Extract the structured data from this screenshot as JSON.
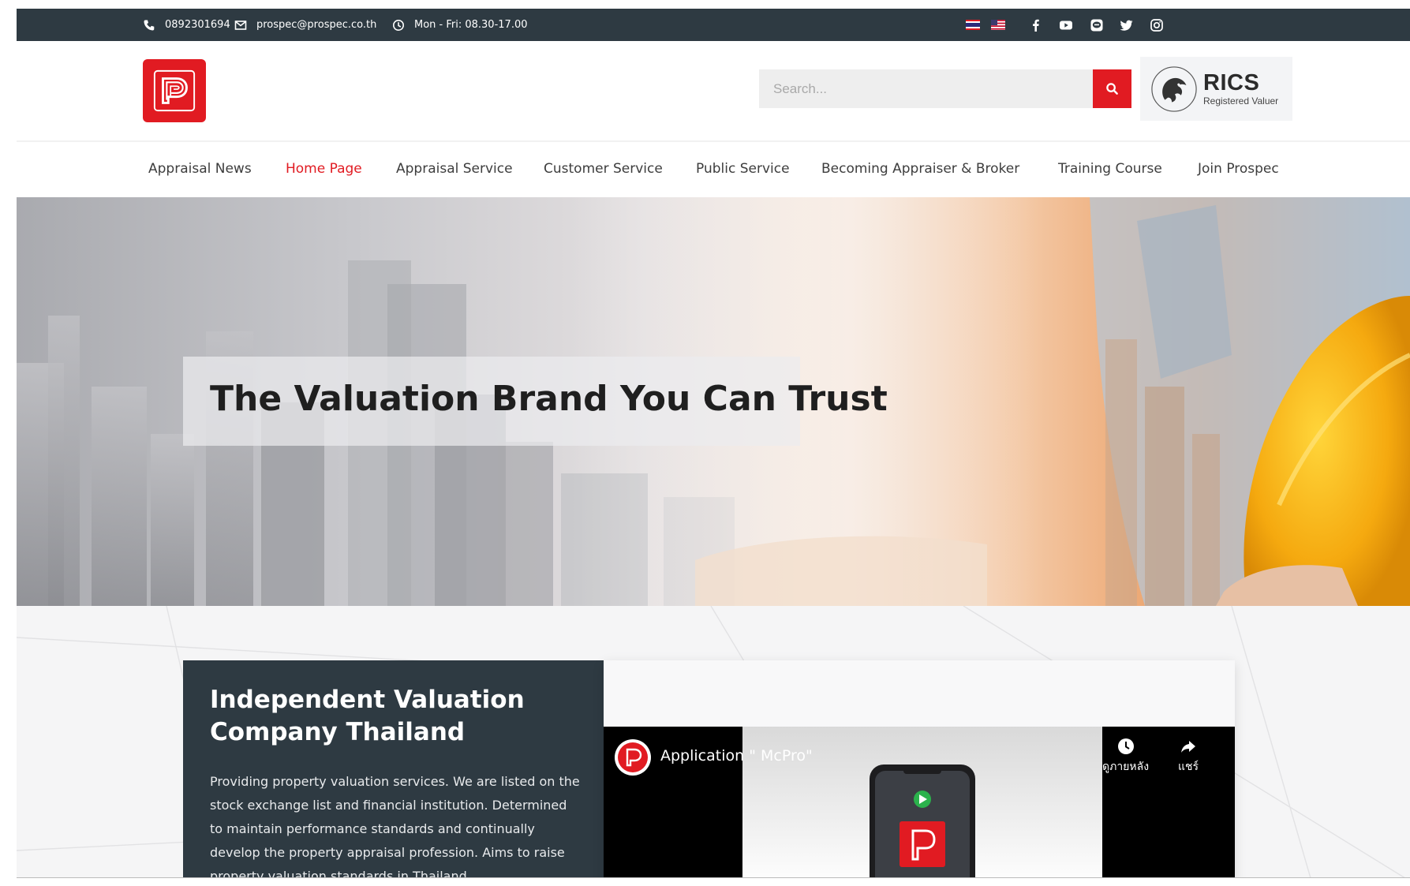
{
  "topbar": {
    "phone": "0892301694",
    "email": "prospec@prospec.co.th",
    "hours": "Mon - Fri: 08.30-17.00",
    "languages": [
      "thai-flag-icon",
      "us-flag-icon"
    ],
    "social_icons": [
      "facebook-icon",
      "youtube-icon",
      "line-icon",
      "twitter-icon",
      "instagram-icon"
    ]
  },
  "header": {
    "search_placeholder": "Search...",
    "rics_title": "RICS",
    "rics_subtitle": "Registered Valuer"
  },
  "nav": {
    "items": [
      {
        "label": "Appraisal News"
      },
      {
        "label": "Home Page"
      },
      {
        "label": "Appraisal Service"
      },
      {
        "label": "Customer Service"
      },
      {
        "label": "Public Service"
      },
      {
        "label": "Becoming Appraiser & Broker"
      },
      {
        "label": "Training Course"
      },
      {
        "label": "Join Prospec"
      }
    ],
    "active_index": 1
  },
  "hero": {
    "title": "The Valuation Brand You Can Trust"
  },
  "about": {
    "title": "Independent Valuation Company Thailand",
    "description": "Providing property valuation services. We are listed on the stock exchange list and financial institution. Determined to maintain performance standards and continually develop the property appraisal profession. Aims to raise property valuation standards in Thailand"
  },
  "video": {
    "title": "Application \" McPro\"",
    "watch_later_label": "ดูภายหลัง",
    "share_label": "แชร์"
  },
  "colors": {
    "brand_red": "#e11b22",
    "topbar_bg": "#2e3a42",
    "nav_active": "#e11b22"
  }
}
